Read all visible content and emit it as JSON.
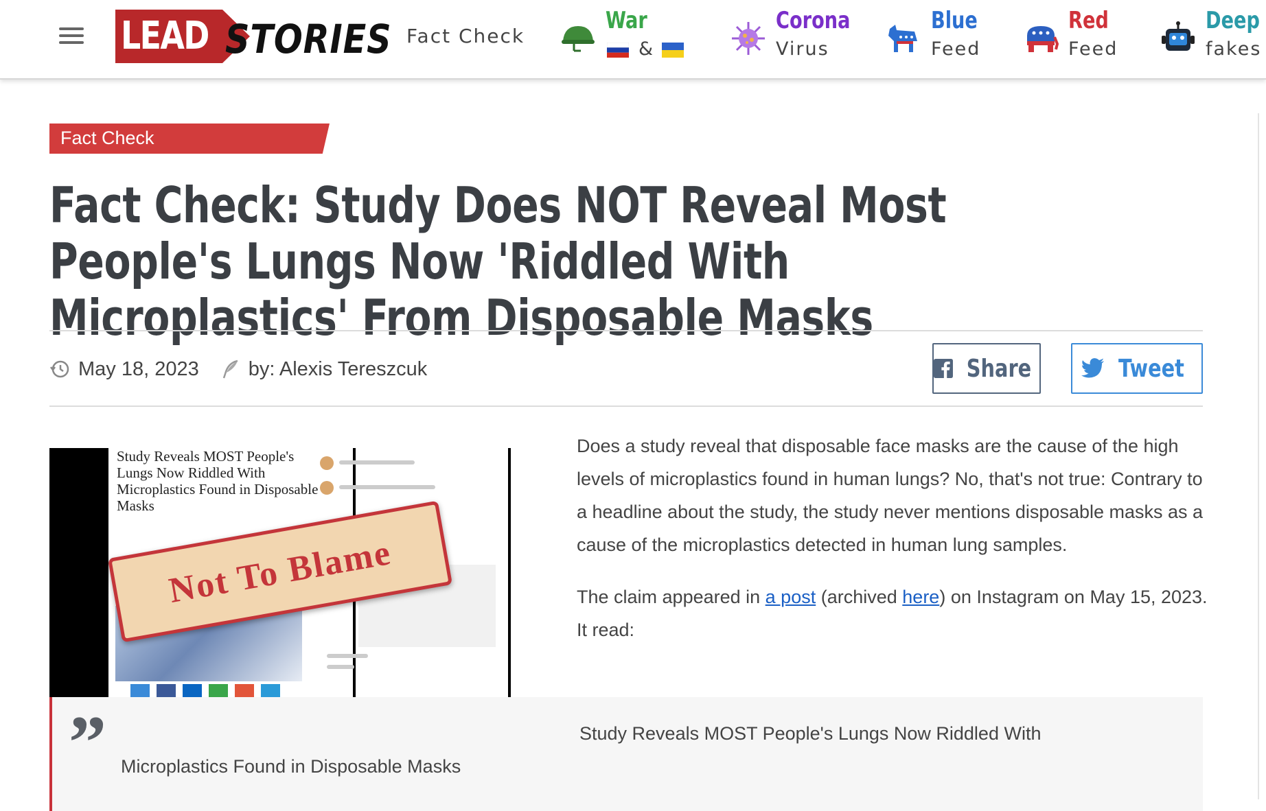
{
  "header": {
    "logo_lead": "LEAD",
    "logo_stories": "STORIES",
    "fact_check_link": "Fact Check",
    "nav": [
      {
        "title": "War",
        "sub": "&",
        "title_color": "#3aa64a",
        "icon": "military-helmet-icon"
      },
      {
        "title": "Corona",
        "sub": "Virus",
        "title_color": "#7a2fc9",
        "icon": "virus-icon"
      },
      {
        "title": "Blue",
        "sub": "Feed",
        "title_color": "#2c6fd1",
        "icon": "democrat-donkey-icon"
      },
      {
        "title": "Red",
        "sub": "Feed",
        "title_color": "#d0323a",
        "icon": "republican-elephant-icon"
      },
      {
        "title": "Deep",
        "sub": "fakes",
        "title_color": "#2a9aa8",
        "icon": "robot-icon"
      }
    ]
  },
  "article": {
    "category_tag": "Fact Check",
    "title": "Fact Check: Study Does NOT Reveal Most People's Lungs Now 'Riddled With Microplastics' From Disposable Masks",
    "date": "May 18, 2023",
    "author": "by: Alexis Tereszcuk",
    "share_label": "Share",
    "tweet_label": "Tweet",
    "image": {
      "mock_headline": "Study Reveals MOST People's Lungs Now Riddled With Microplastics Found in Disposable Masks",
      "stamp_text": "Not To Blame"
    },
    "paragraph1": "Does a study reveal that disposable face masks are the cause of the high levels of microplastics found in human lungs? No, that's not true: Contrary to a headline about the study, the study never mentions disposable masks as a cause of the microplastics detected in human lung samples.",
    "paragraph2": {
      "before_link1": "The claim appeared in ",
      "link1": "a post",
      "middle": " (archived ",
      "link2": "here",
      "after": ") on Instagram on May 15, 2023. It read:"
    },
    "quote": {
      "mark": "”",
      "line1": "Study Reveals MOST People's Lungs Now Riddled With",
      "line2": "Microplastics Found in Disposable Masks"
    }
  },
  "colors": {
    "brand_red": "#b8282a",
    "tag_red": "#d23c3c",
    "title_gray": "#3b3f44",
    "link_blue": "#1a5fc5",
    "share_border": "#52657d",
    "tweet_blue": "#3a8ad8"
  }
}
